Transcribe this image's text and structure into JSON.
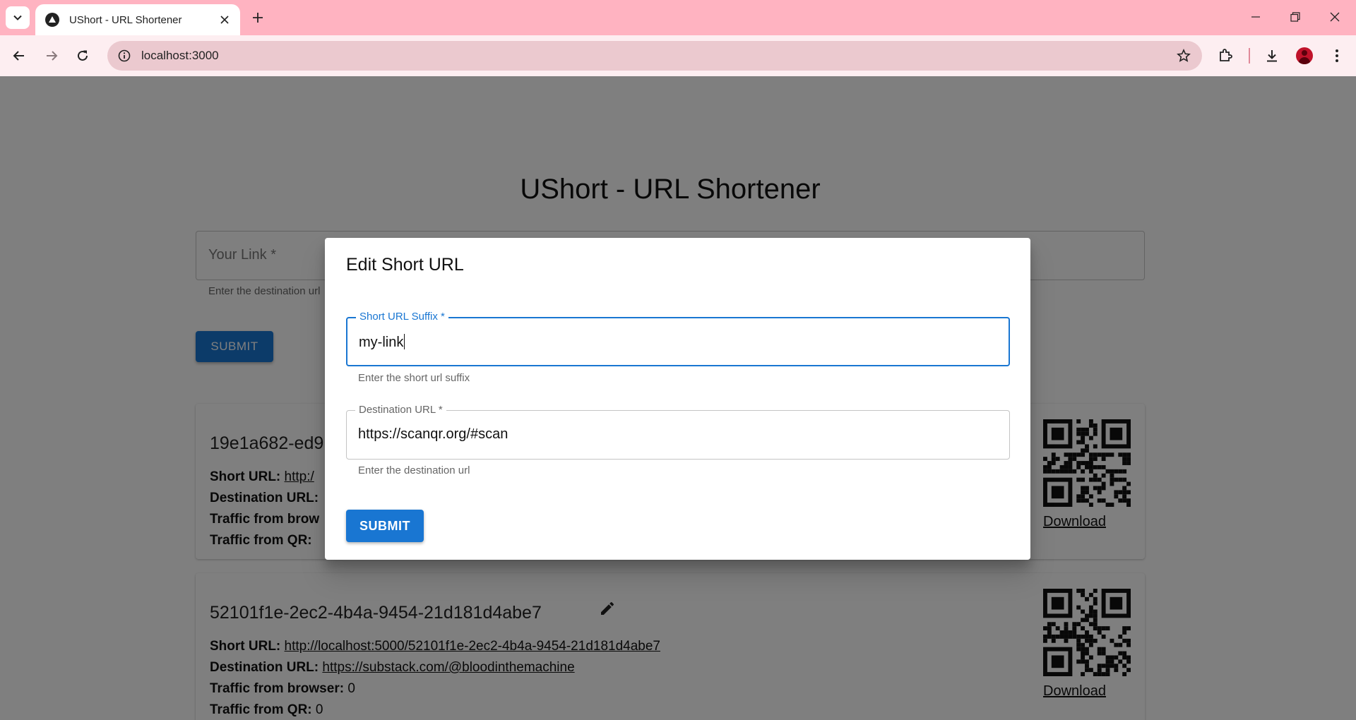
{
  "browser": {
    "tab_title": "UShort - URL Shortener",
    "address": "localhost:3000"
  },
  "page": {
    "title": "UShort - URL Shortener",
    "link_placeholder": "Your Link *",
    "link_helper": "Enter the destination url",
    "submit_label": "SUBMIT",
    "cards": [
      {
        "id": "19e1a682-ed9",
        "short_label": "Short URL:",
        "short_url": "http:/",
        "dest_label": "Destination URL:",
        "dest_url": "",
        "browser_label": "Traffic from brow",
        "browser_count": "",
        "qr_label": "Traffic from QR:",
        "qr_count": "",
        "download_label": "Download"
      },
      {
        "id": "52101f1e-2ec2-4b4a-9454-21d181d4abe7",
        "short_label": "Short URL:",
        "short_url": "http://localhost:5000/52101f1e-2ec2-4b4a-9454-21d181d4abe7",
        "dest_label": "Destination URL:",
        "dest_url": "https://substack.com/@bloodinthemachine",
        "browser_label": "Traffic from browser:",
        "browser_count": "0",
        "qr_label": "Traffic from QR:",
        "qr_count": "0",
        "download_label": "Download"
      }
    ]
  },
  "dialog": {
    "title": "Edit Short URL",
    "suffix_label": "Short URL Suffix *",
    "suffix_value": "my-link",
    "suffix_helper": "Enter the short url suffix",
    "dest_label": "Destination URL *",
    "dest_value": "https://scanqr.org/#scan",
    "dest_helper": "Enter the destination url",
    "submit_label": "SUBMIT"
  },
  "colors": {
    "chrome_bg": "#ffb3c1",
    "primary": "#1976d2",
    "backdrop": "rgba(0,0,0,0.5)"
  }
}
